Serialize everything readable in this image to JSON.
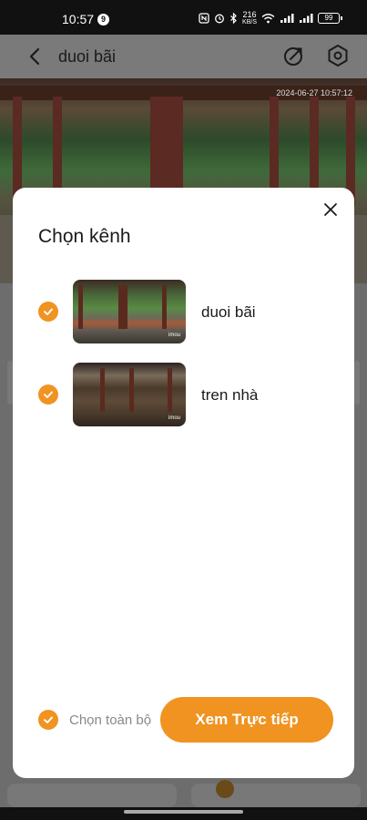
{
  "status_bar": {
    "time": "10:57",
    "notification_count": "9",
    "net_speed_value": "216",
    "net_speed_unit": "KB/S",
    "battery": "99"
  },
  "header": {
    "title": "duoi bãi",
    "back_icon": "chevron-left-icon",
    "share_icon": "share-out-icon",
    "settings_icon": "settings-gear-icon"
  },
  "video": {
    "timestamp": "2024-06-27 10:57:12"
  },
  "modal": {
    "title": "Chọn kênh",
    "close_icon": "close-icon",
    "channels": [
      {
        "name": "duoi bãi",
        "checked": true,
        "watermark": "imou"
      },
      {
        "name": "tren nhà",
        "checked": true,
        "watermark": "imou"
      }
    ],
    "select_all_label": "Chọn toàn bộ",
    "select_all_checked": true,
    "primary_button": "Xem Trực tiếp"
  },
  "colors": {
    "accent": "#f09321",
    "header_bg": "#7a7a7a",
    "modal_bg": "#ffffff"
  }
}
